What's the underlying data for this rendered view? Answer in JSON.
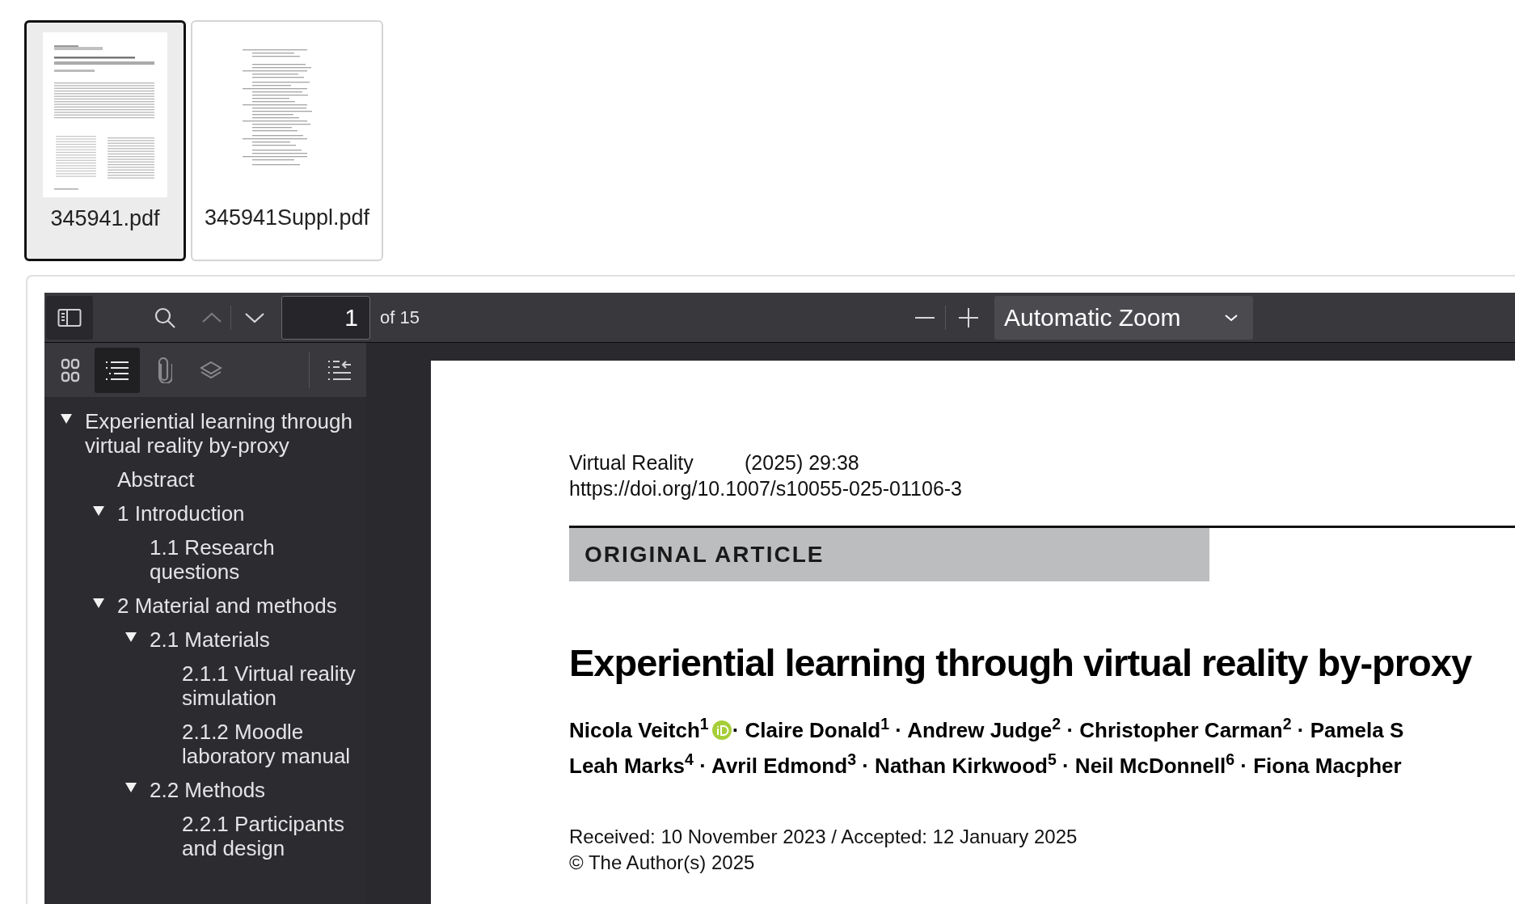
{
  "files": [
    {
      "name": "345941.pdf",
      "selected": true,
      "kind": "article"
    },
    {
      "name": "345941Suppl.pdf",
      "selected": false,
      "kind": "questionnaire"
    }
  ],
  "toolbar": {
    "page_number": "1",
    "page_count": "of 15",
    "zoom": "Automatic Zoom"
  },
  "sidebar": {
    "views": [
      {
        "kind": "thumbnails",
        "selected": false
      },
      {
        "kind": "outline",
        "selected": true
      },
      {
        "kind": "attachments",
        "selected": false
      },
      {
        "kind": "layers",
        "selected": false
      }
    ],
    "outline": [
      {
        "title": "Experiential learning through virtual reality by-proxy",
        "expanded": true,
        "children": [
          {
            "title": "Abstract"
          },
          {
            "title": "1 Introduction",
            "expanded": true,
            "children": [
              {
                "title": "1.1 Research questions"
              }
            ]
          },
          {
            "title": "2 Material and methods",
            "expanded": true,
            "children": [
              {
                "title": "2.1 Materials",
                "expanded": true,
                "children": [
                  {
                    "title": "2.1.1 Virtual reality simulation"
                  },
                  {
                    "title": "2.1.2 Moodle laboratory manual"
                  }
                ]
              },
              {
                "title": "2.2 Methods",
                "expanded": true,
                "children": [
                  {
                    "title": "2.2.1 Participants and design"
                  }
                ]
              }
            ]
          }
        ]
      }
    ]
  },
  "document": {
    "journal": "Virtual Reality",
    "citation": "(2025) 29:38",
    "doi": "https://doi.org/10.1007/s10055-025-01106-3",
    "article_type": "ORIGINAL ARTICLE",
    "title": "Experiential learning through virtual reality by-proxy",
    "author_lines": [
      [
        {
          "text": "Nicola Veitch$^{1}$",
          "orcid": true
        },
        {
          "text": " · Claire Donald$^{1}$ · Andrew Judge$^{2}$ · Christopher Carman$^{2}$ · Pamela S",
          "orcid": false
        }
      ],
      [
        {
          "text": "Leah Marks$^{4}$ · Avril Edmond$^{3}$ · Nathan Kirkwood$^{5}$ · Neil McDonnell$^{6}$ · Fiona Macpher",
          "orcid": false
        }
      ]
    ],
    "dates": "Received: 10 November 2023 / Accepted: 12 January 2025",
    "copyright": "© The Author(s) 2025"
  }
}
